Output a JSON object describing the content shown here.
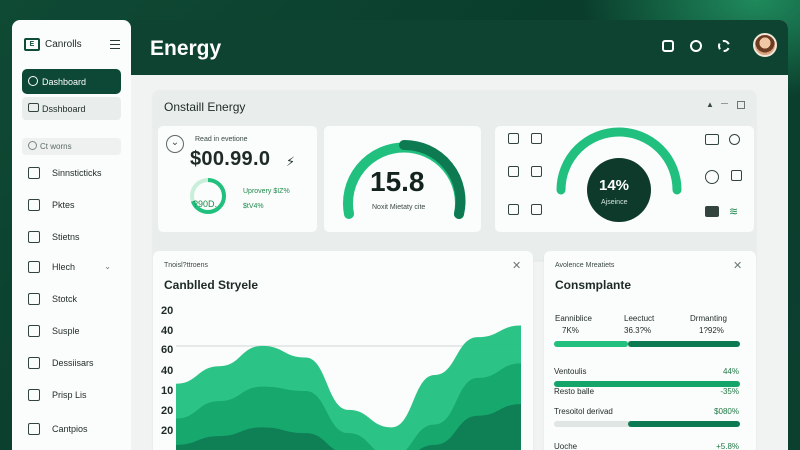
{
  "app": {
    "name": "Canrolls"
  },
  "header": {
    "title": "Energy"
  },
  "sidebar": {
    "active": "Dashboard",
    "second": "Dsshboard",
    "search_placeholder": "Ct worns",
    "items": [
      {
        "label": "Sinnsticticks",
        "icon": "chart-icon"
      },
      {
        "label": "Pktes",
        "icon": "grid-icon"
      },
      {
        "label": "Stietns",
        "icon": "list-icon"
      },
      {
        "label": "Hlech",
        "icon": "bell-icon"
      },
      {
        "label": "Stotck",
        "icon": "box-icon"
      },
      {
        "label": "Susple",
        "icon": "cart-icon"
      },
      {
        "label": "Dessiisars",
        "icon": "folder-icon"
      },
      {
        "label": "Prisp Lis",
        "icon": "home-icon"
      },
      {
        "label": "Cantpios",
        "icon": "gear-icon"
      }
    ]
  },
  "overview": {
    "title": "Onstaill Energy",
    "stat": {
      "caption": "Read in evetione",
      "value": "$00.99.0",
      "ring_label": "?90D.",
      "sub1": "Uprovery $IZ%",
      "sub2": "$tV4%"
    },
    "gauge1": {
      "value": "15.8",
      "caption": "Noxit Mietaty cite",
      "level": 0.62
    },
    "gauge2": {
      "value": "14%",
      "caption": "Ajseince",
      "level": 0.45
    }
  },
  "chart_card": {
    "subtitle": "Tnoisl?ttroens",
    "title": "Canblled Stryele",
    "y_ticks": [
      "20",
      "40",
      "60",
      "40",
      "10",
      "20",
      "20"
    ]
  },
  "chart_data": {
    "type": "area",
    "title": "Canblled Stryele",
    "series": [
      {
        "values": [
          60,
          72,
          86,
          78,
          42,
          30,
          66,
          92,
          100
        ]
      },
      {
        "values": [
          36,
          48,
          58,
          55,
          26,
          10,
          32,
          64,
          74
        ]
      },
      {
        "values": [
          18,
          24,
          30,
          26,
          12,
          4,
          18,
          38,
          46
        ]
      }
    ],
    "colors": [
      "#21c07f",
      "#15a56a",
      "#0e7a52"
    ]
  },
  "compliance": {
    "subtitle": "Avolence Mreatiets",
    "title": "Consmplante",
    "cols": [
      {
        "head": "Eanniblice",
        "value": "7K%"
      },
      {
        "head": "Leectuct",
        "value": "36.3?%"
      },
      {
        "head": "Drmanting",
        "value": "1?92%"
      }
    ],
    "bar_top": {
      "light": 0.45,
      "dark": 0.55
    },
    "rows": [
      {
        "label": "Ventoulis",
        "value": "44%",
        "bar": 1.0
      },
      {
        "label": "Resto balle",
        "value": "-35%",
        "bar": 0.0
      },
      {
        "label": "Tresoitol derivad",
        "value": "$080%",
        "bar": 0.6
      },
      {
        "label": "Uoche",
        "value": "+5.8%",
        "bar": 0.0
      }
    ]
  },
  "colors": {
    "dark_green": "#0e4332",
    "accent": "#21c07f",
    "mid_green": "#15a56a"
  }
}
